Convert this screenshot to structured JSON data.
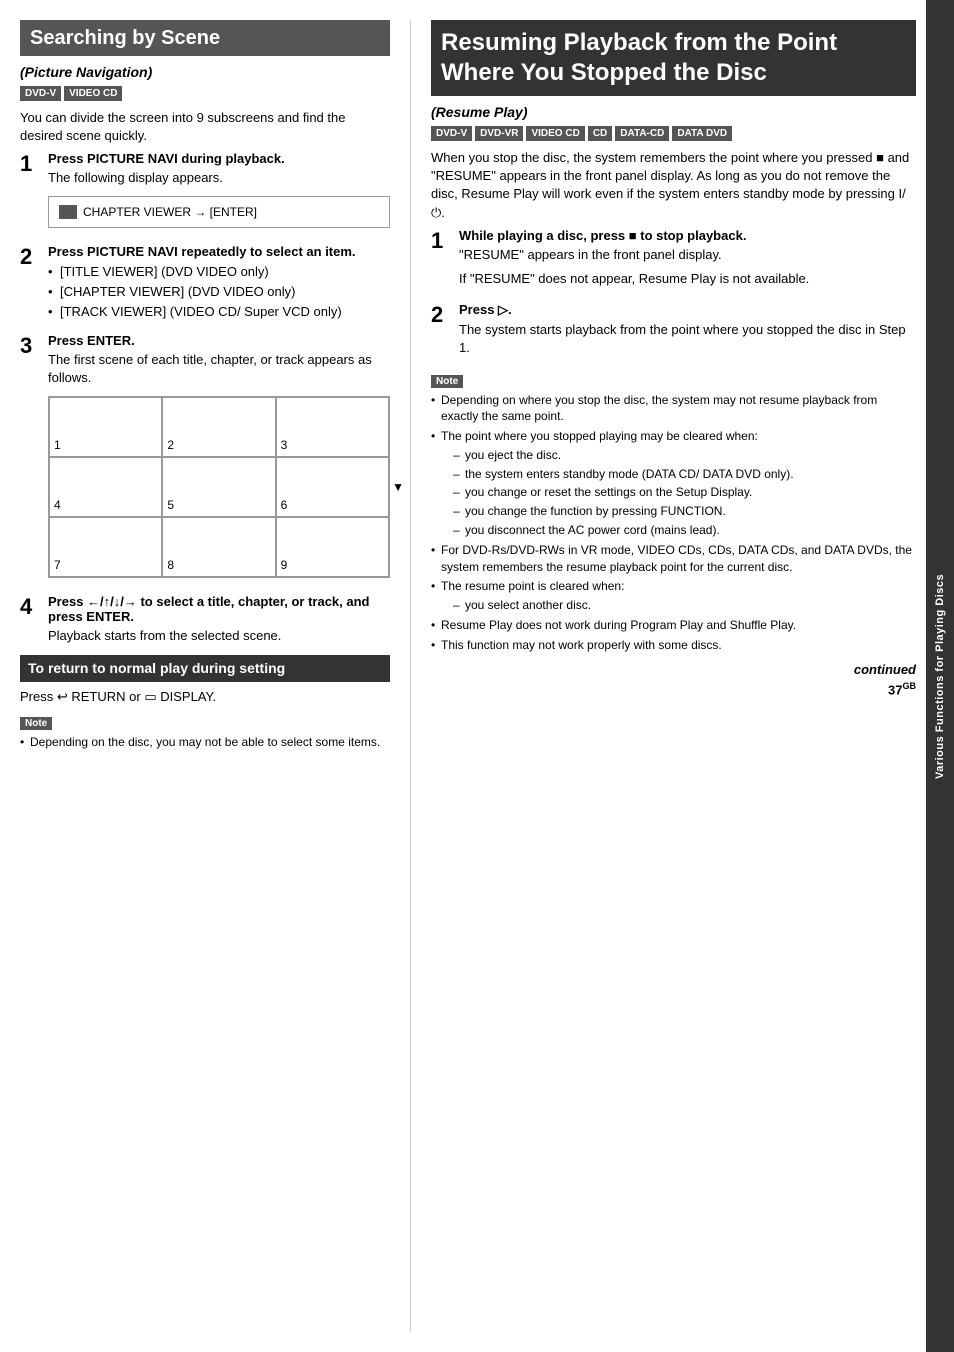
{
  "left": {
    "header": "Searching by Scene",
    "subtitle": "(Picture Navigation)",
    "badges": [
      "DVD-V",
      "VIDEO CD"
    ],
    "intro": "You can divide the screen into 9 subscreens and find the desired scene quickly.",
    "step1": {
      "num": "1",
      "title": "Press PICTURE NAVI during playback.",
      "body": "The following display appears."
    },
    "viewer_box_text": "CHAPTER VIEWER → [ENTER]",
    "step2": {
      "num": "2",
      "title": "Press PICTURE NAVI repeatedly to select an item.",
      "bullets": [
        "[TITLE VIEWER] (DVD VIDEO only)",
        "[CHAPTER VIEWER] (DVD VIDEO only)",
        "[TRACK VIEWER] (VIDEO CD/ Super VCD only)"
      ]
    },
    "step3": {
      "num": "3",
      "title": "Press ENTER.",
      "body": "The first scene of each title, chapter, or track appears as follows."
    },
    "grid_cells": [
      "1",
      "2",
      "3",
      "4",
      "5",
      "6",
      "7",
      "8",
      "9"
    ],
    "step4": {
      "num": "4",
      "title": "Press ←/↑/↓/→ to select a title, chapter, or track, and press ENTER.",
      "body": "Playback starts from the selected scene."
    },
    "return_heading": "To return to normal play during setting",
    "return_body": "Press  RETURN or  DISPLAY.",
    "note_label": "Note",
    "note_items": [
      "Depending on the disc, you may not be able to select some items."
    ]
  },
  "right": {
    "header": "Resuming Playback from the Point Where You Stopped the Disc",
    "subtitle": "(Resume Play)",
    "badges": [
      "DVD-V",
      "DVD-VR",
      "VIDEO CD",
      "CD",
      "DATA-CD",
      "DATA DVD"
    ],
    "intro": "When you stop the disc, the system remembers the point where you pressed ■ and \"RESUME\" appears in the front panel display. As long as you do not remove the disc, Resume Play will work even if the system enters standby mode by pressing I/⏻.",
    "step1": {
      "num": "1",
      "title": "While playing a disc, press ■ to stop playback.",
      "body1": "\"RESUME\" appears in the front panel display.",
      "body2": "If \"RESUME\" does not appear, Resume Play is not available."
    },
    "step2": {
      "num": "2",
      "title": "Press ▷.",
      "body": "The system starts playback from the point where you stopped the disc in Step 1."
    },
    "note_label": "Note",
    "note_items": [
      "Depending on where you stop the disc, the system may not resume playback from exactly the same point.",
      "The point where you stopped playing may be cleared when:"
    ],
    "note_sub1": [
      "you eject the disc.",
      "the system enters standby mode (DATA CD/ DATA DVD only).",
      "you change or reset the settings on the Setup Display.",
      "you change the function by pressing FUNCTION.",
      "you disconnect the AC power cord (mains lead)."
    ],
    "note_items2": [
      "For DVD-Rs/DVD-RWs in VR mode, VIDEO CDs, CDs, DATA CDs, and DATA DVDs, the system remembers the resume playback point for the current disc.",
      "The resume point is cleared when:"
    ],
    "note_sub2": [
      "you select another disc."
    ],
    "note_items3": [
      "Resume Play does not work during Program Play and Shuffle Play.",
      "This function may not work properly with some discs."
    ],
    "continued": "continued",
    "page_num": "37"
  },
  "side_tab": "Various Functions for Playing Discs"
}
